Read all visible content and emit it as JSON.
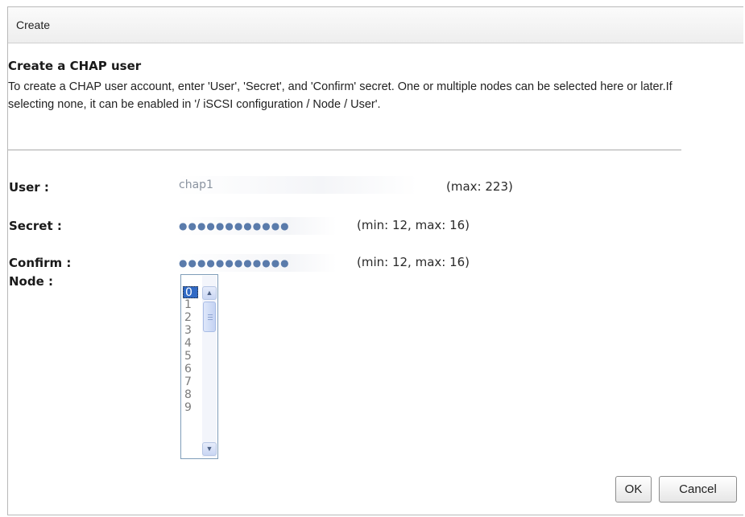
{
  "window": {
    "title": "Create"
  },
  "form": {
    "heading": "Create a CHAP user",
    "description": "To create a CHAP user account, enter 'User', 'Secret', and 'Confirm' secret. One or multiple nodes can be selected here or later.If selecting none, it can be enabled in '/ iSCSI configuration / Node / User'.",
    "user": {
      "label": "User :",
      "value": "chap1",
      "hint": "(max: 223)"
    },
    "secret": {
      "label": "Secret :",
      "value": "●●●●●●●●●●●●",
      "hint": "(min: 12, max: 16)"
    },
    "confirm": {
      "label": "Confirm :",
      "value": "●●●●●●●●●●●●",
      "hint": "(min: 12, max: 16)"
    },
    "node": {
      "label": "Node :",
      "options": [
        "0",
        "1",
        "2",
        "3",
        "4",
        "5",
        "6",
        "7",
        "8",
        "9"
      ],
      "selected": "0"
    }
  },
  "buttons": {
    "ok": "OK",
    "cancel": "Cancel"
  },
  "icons": {
    "scroll_up": "chevron-up-icon",
    "scroll_down": "chevron-down-icon"
  },
  "colors": {
    "selection": "#316ac5",
    "listbox_border": "#7f9db9"
  }
}
